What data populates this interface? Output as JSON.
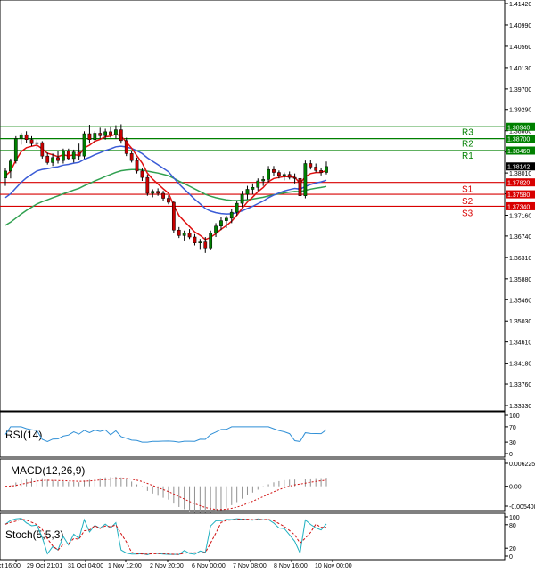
{
  "chart_data": {
    "type": "candlestick",
    "price_axis": {
      "ylim": [
        1.3333,
        1.4142
      ],
      "ticks": [
        "1.41420",
        "1.40990",
        "1.40560",
        "1.40130",
        "1.39700",
        "1.39290",
        "1.38860",
        "1.38430",
        "1.38010",
        "1.37590",
        "1.37160",
        "1.36740",
        "1.36310",
        "1.35880",
        "1.35460",
        "1.35030",
        "1.34610",
        "1.34180",
        "1.33760",
        "1.33330"
      ],
      "current_price": "1.38142"
    },
    "x_labels": [
      "ct 16:00",
      "29 Oct 21:01",
      "31 Oct 04:00",
      "1 Nov 12:00",
      "2 Nov 20:00",
      "6 Nov 00:00",
      "7 Nov 08:00",
      "8 Nov 16:00",
      "10 Nov 00:00"
    ],
    "levels": [
      {
        "name": "R3",
        "value": 1.3894,
        "label": "1.38940",
        "kind": "resistance"
      },
      {
        "name": "R2",
        "value": 1.387,
        "label": "1.38700",
        "kind": "resistance"
      },
      {
        "name": "R1",
        "value": 1.3846,
        "label": "1.38460",
        "kind": "resistance"
      },
      {
        "name": "S1",
        "value": 1.3782,
        "label": "1.37820",
        "kind": "support"
      },
      {
        "name": "S2",
        "value": 1.3758,
        "label": "1.37580",
        "kind": "support"
      },
      {
        "name": "S3",
        "value": 1.3734,
        "label": "1.37340",
        "kind": "support"
      }
    ],
    "candles": [
      [
        1.3791,
        1.3812,
        1.3775,
        1.3805
      ],
      [
        1.3805,
        1.383,
        1.379,
        1.3825
      ],
      [
        1.3825,
        1.3875,
        1.382,
        1.387
      ],
      [
        1.387,
        1.3882,
        1.3858,
        1.3878
      ],
      [
        1.3878,
        1.3885,
        1.3862,
        1.3868
      ],
      [
        1.3868,
        1.3875,
        1.3855,
        1.386
      ],
      [
        1.386,
        1.3868,
        1.385,
        1.3862
      ],
      [
        1.3862,
        1.3865,
        1.383,
        1.3835
      ],
      [
        1.3835,
        1.3842,
        1.3818,
        1.3822
      ],
      [
        1.3822,
        1.384,
        1.3815,
        1.3832
      ],
      [
        1.3832,
        1.3845,
        1.382,
        1.3826
      ],
      [
        1.3826,
        1.385,
        1.382,
        1.3845
      ],
      [
        1.3845,
        1.385,
        1.3828,
        1.383
      ],
      [
        1.383,
        1.3848,
        1.3822,
        1.3843
      ],
      [
        1.3843,
        1.386,
        1.3828,
        1.3835
      ],
      [
        1.3835,
        1.3885,
        1.383,
        1.388
      ],
      [
        1.388,
        1.3898,
        1.386,
        1.3868
      ],
      [
        1.3868,
        1.3885,
        1.3862,
        1.3881
      ],
      [
        1.3881,
        1.3892,
        1.387,
        1.3876
      ],
      [
        1.3876,
        1.389,
        1.3868,
        1.3884
      ],
      [
        1.3884,
        1.3895,
        1.3872,
        1.3878
      ],
      [
        1.3878,
        1.3897,
        1.387,
        1.3888
      ],
      [
        1.3888,
        1.3899,
        1.386,
        1.3866
      ],
      [
        1.3866,
        1.3872,
        1.3835,
        1.384
      ],
      [
        1.384,
        1.3845,
        1.3822,
        1.3826
      ],
      [
        1.3826,
        1.3832,
        1.38,
        1.3805
      ],
      [
        1.3805,
        1.381,
        1.3785,
        1.3792
      ],
      [
        1.3792,
        1.3798,
        1.3755,
        1.376
      ],
      [
        1.376,
        1.3768,
        1.3752,
        1.3764
      ],
      [
        1.3764,
        1.377,
        1.3755,
        1.376
      ],
      [
        1.376,
        1.3765,
        1.3745,
        1.375
      ],
      [
        1.375,
        1.3756,
        1.3738,
        1.3742
      ],
      [
        1.3742,
        1.3745,
        1.368,
        1.3686
      ],
      [
        1.3686,
        1.3692,
        1.367,
        1.3675
      ],
      [
        1.3675,
        1.3685,
        1.3665,
        1.368
      ],
      [
        1.368,
        1.3688,
        1.3668,
        1.3672
      ],
      [
        1.3672,
        1.3678,
        1.3655,
        1.366
      ],
      [
        1.366,
        1.3668,
        1.3648,
        1.3662
      ],
      [
        1.3662,
        1.3672,
        1.364,
        1.365
      ],
      [
        1.365,
        1.3685,
        1.3646,
        1.368
      ],
      [
        1.368,
        1.37,
        1.3672,
        1.3694
      ],
      [
        1.3694,
        1.3712,
        1.3686,
        1.3705
      ],
      [
        1.3705,
        1.3715,
        1.369,
        1.371
      ],
      [
        1.371,
        1.3728,
        1.37,
        1.3722
      ],
      [
        1.3722,
        1.3745,
        1.3715,
        1.374
      ],
      [
        1.374,
        1.3765,
        1.3732,
        1.3758
      ],
      [
        1.3758,
        1.3775,
        1.3748,
        1.3768
      ],
      [
        1.3768,
        1.378,
        1.3758,
        1.3772
      ],
      [
        1.3772,
        1.379,
        1.3765,
        1.3785
      ],
      [
        1.3785,
        1.3795,
        1.3775,
        1.3788
      ],
      [
        1.3788,
        1.3815,
        1.3782,
        1.3808
      ],
      [
        1.3808,
        1.3815,
        1.3795,
        1.3802
      ],
      [
        1.3802,
        1.3806,
        1.379,
        1.3796
      ],
      [
        1.3796,
        1.3802,
        1.3786,
        1.3798
      ],
      [
        1.3798,
        1.3804,
        1.3788,
        1.3792
      ],
      [
        1.3792,
        1.38,
        1.378,
        1.379
      ],
      [
        1.379,
        1.3795,
        1.375,
        1.3755
      ],
      [
        1.3755,
        1.3826,
        1.375,
        1.382
      ],
      [
        1.382,
        1.3828,
        1.3808,
        1.3813
      ],
      [
        1.3813,
        1.382,
        1.3802,
        1.3806
      ],
      [
        1.3806,
        1.3812,
        1.3796,
        1.3802
      ],
      [
        1.3802,
        1.3824,
        1.3798,
        1.3814
      ]
    ],
    "indicators": {
      "rsi": {
        "label": "RSI(14)",
        "ticks": [
          "100",
          "70",
          "30",
          "0"
        ],
        "color": "#2f8fd6"
      },
      "macd": {
        "label": "MACD(12,26,9)",
        "ticks": [
          "0.006225",
          "0.00",
          "-0.005408"
        ]
      },
      "stoch": {
        "label": "Stoch(5,5,3)",
        "ticks": [
          "100",
          "80",
          "20",
          "0"
        ]
      }
    },
    "colors": {
      "bull": "#008000",
      "bear": "#c80000",
      "resistance": "#008000",
      "support": "#d80000",
      "ma_blue": "#3a5bd6",
      "ma_red": "#e01010",
      "ma_green": "#30a050",
      "current_box": "#000000"
    },
    "grid": false
  }
}
